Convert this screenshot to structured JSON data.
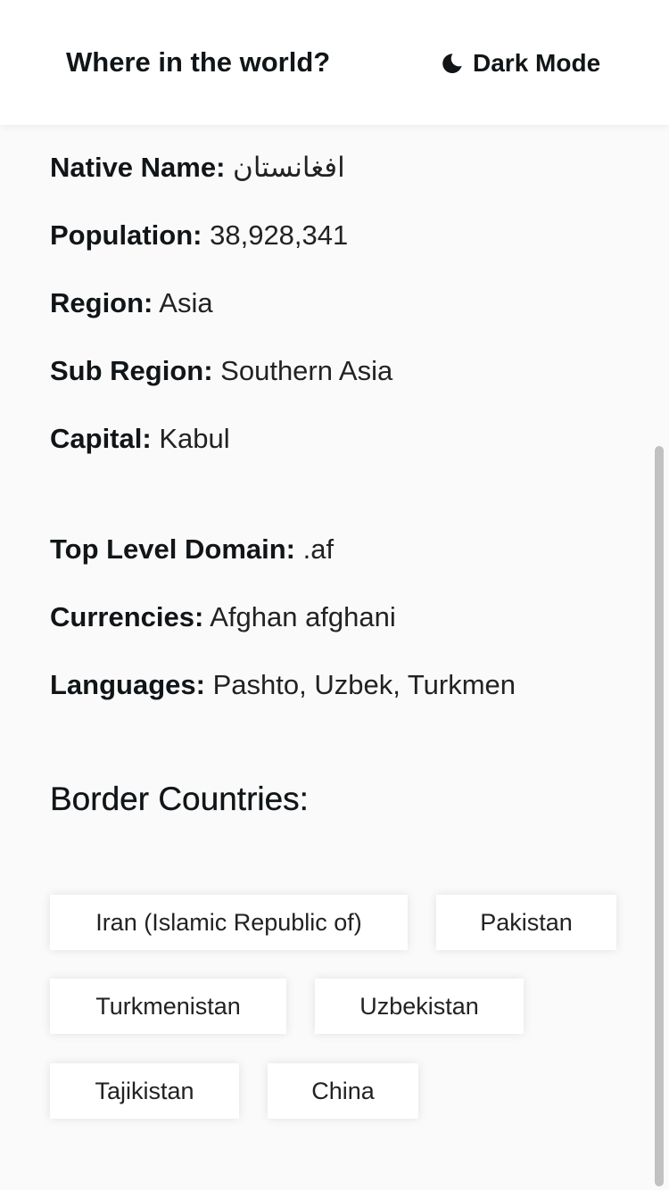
{
  "header": {
    "title": "Where in the world?",
    "theme_toggle_label": "Dark Mode",
    "theme_icon": "moon-icon"
  },
  "details": {
    "native_name": {
      "label": "Native Name:",
      "value": "افغانستان"
    },
    "population": {
      "label": "Population:",
      "value": "38,928,341"
    },
    "region": {
      "label": "Region:",
      "value": "Asia"
    },
    "sub_region": {
      "label": "Sub Region:",
      "value": "Southern Asia"
    },
    "capital": {
      "label": "Capital:",
      "value": "Kabul"
    },
    "top_level_domain": {
      "label": "Top Level Domain:",
      "value": ".af"
    },
    "currencies": {
      "label": "Currencies:",
      "value": "Afghan afghani"
    },
    "languages": {
      "label": "Languages:",
      "value": "Pashto, Uzbek, Turkmen"
    }
  },
  "border": {
    "title": "Border Countries:",
    "countries": [
      "Iran (Islamic Republic of)",
      "Pakistan",
      "Turkmenistan",
      "Uzbekistan",
      "Tajikistan",
      "China"
    ]
  }
}
